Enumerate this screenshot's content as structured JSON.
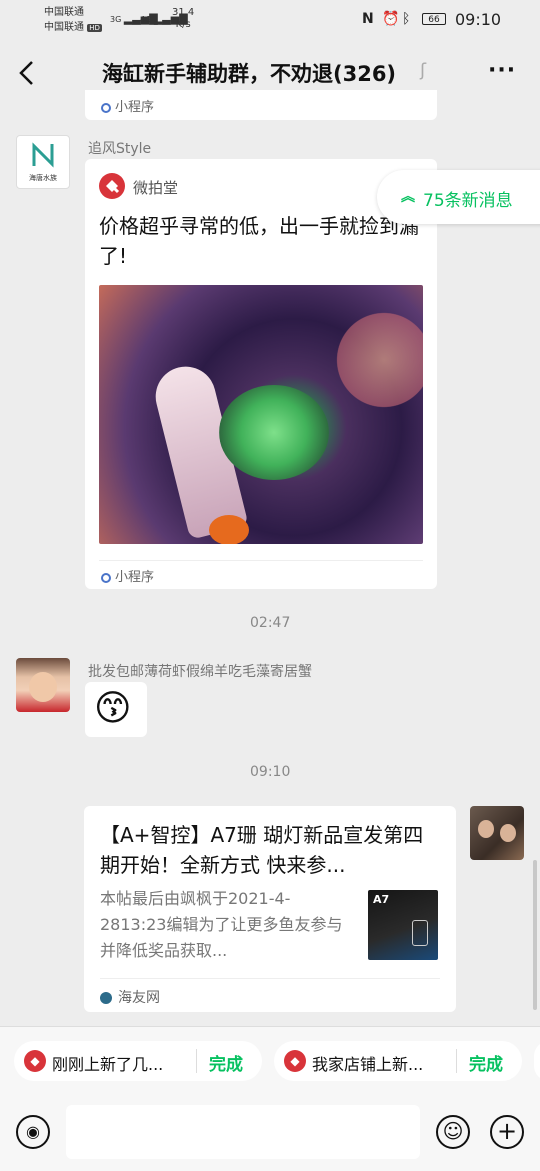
{
  "status_bar": {
    "carrier1": "中国联通",
    "carrier2": "中国联通",
    "hd_badge": "HD",
    "net1": "3G",
    "net2": "4G",
    "speed_value": "31.4",
    "speed_unit": "K/s",
    "battery": "66",
    "time": "09:10"
  },
  "nav": {
    "title": "海缸新手辅助群，不劝退(326)"
  },
  "messages": {
    "top_card_source": "小程序",
    "msg1": {
      "sender": "追风Style",
      "avatar_text": "海唐水族",
      "app_name": "微拍堂",
      "title": "价格超乎寻常的低，出一手就捡到漏了!",
      "source": "小程序"
    },
    "time1": "02:47",
    "msg2": {
      "sender": "批发包邮薄荷虾假绵羊吃毛藻寄居蟹",
      "emoji": "😙"
    },
    "time2": "09:10",
    "msg3": {
      "title": "【A+智控】A7珊 瑚灯新品宣发第四期开始！全新方式 快来参...",
      "desc": "本帖最后由飒枫于2021-4-2813:23编辑为了让更多鱼友参与并降低奖品获取...",
      "thumb_label": "A7",
      "source": "海友网"
    }
  },
  "new_messages": "75条新消息",
  "quick_replies": [
    {
      "text": "刚刚上新了几...",
      "action": "完成"
    },
    {
      "text": "我家店铺上新...",
      "action": "完成"
    }
  ],
  "colors": {
    "wechat_green": "#07c160",
    "app_red": "#d8343a",
    "background": "#ededed"
  }
}
